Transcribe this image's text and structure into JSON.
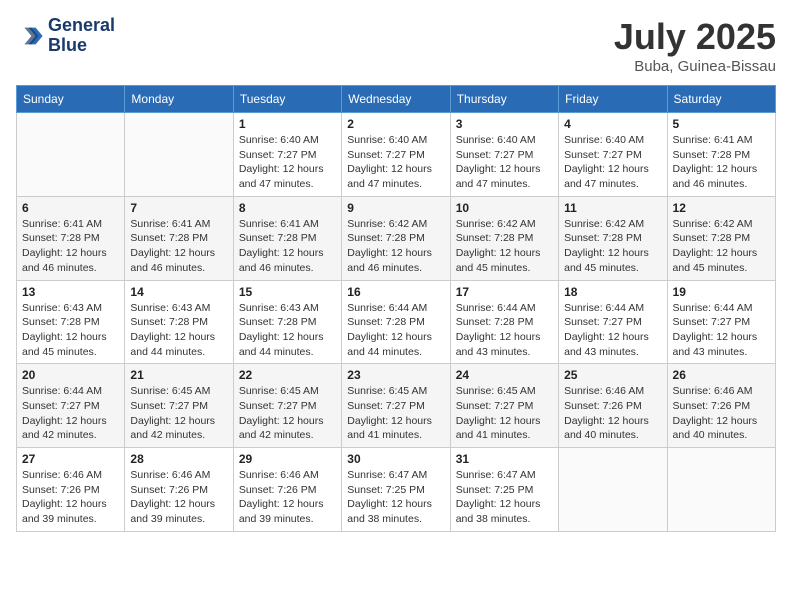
{
  "header": {
    "logo_line1": "General",
    "logo_line2": "Blue",
    "month_title": "July 2025",
    "location": "Buba, Guinea-Bissau"
  },
  "weekdays": [
    "Sunday",
    "Monday",
    "Tuesday",
    "Wednesday",
    "Thursday",
    "Friday",
    "Saturday"
  ],
  "weeks": [
    [
      null,
      null,
      {
        "day": 1,
        "sunrise": "6:40 AM",
        "sunset": "7:27 PM",
        "daylight": "12 hours and 47 minutes."
      },
      {
        "day": 2,
        "sunrise": "6:40 AM",
        "sunset": "7:27 PM",
        "daylight": "12 hours and 47 minutes."
      },
      {
        "day": 3,
        "sunrise": "6:40 AM",
        "sunset": "7:27 PM",
        "daylight": "12 hours and 47 minutes."
      },
      {
        "day": 4,
        "sunrise": "6:40 AM",
        "sunset": "7:27 PM",
        "daylight": "12 hours and 47 minutes."
      },
      {
        "day": 5,
        "sunrise": "6:41 AM",
        "sunset": "7:28 PM",
        "daylight": "12 hours and 46 minutes."
      }
    ],
    [
      {
        "day": 6,
        "sunrise": "6:41 AM",
        "sunset": "7:28 PM",
        "daylight": "12 hours and 46 minutes."
      },
      {
        "day": 7,
        "sunrise": "6:41 AM",
        "sunset": "7:28 PM",
        "daylight": "12 hours and 46 minutes."
      },
      {
        "day": 8,
        "sunrise": "6:41 AM",
        "sunset": "7:28 PM",
        "daylight": "12 hours and 46 minutes."
      },
      {
        "day": 9,
        "sunrise": "6:42 AM",
        "sunset": "7:28 PM",
        "daylight": "12 hours and 46 minutes."
      },
      {
        "day": 10,
        "sunrise": "6:42 AM",
        "sunset": "7:28 PM",
        "daylight": "12 hours and 45 minutes."
      },
      {
        "day": 11,
        "sunrise": "6:42 AM",
        "sunset": "7:28 PM",
        "daylight": "12 hours and 45 minutes."
      },
      {
        "day": 12,
        "sunrise": "6:42 AM",
        "sunset": "7:28 PM",
        "daylight": "12 hours and 45 minutes."
      }
    ],
    [
      {
        "day": 13,
        "sunrise": "6:43 AM",
        "sunset": "7:28 PM",
        "daylight": "12 hours and 45 minutes."
      },
      {
        "day": 14,
        "sunrise": "6:43 AM",
        "sunset": "7:28 PM",
        "daylight": "12 hours and 44 minutes."
      },
      {
        "day": 15,
        "sunrise": "6:43 AM",
        "sunset": "7:28 PM",
        "daylight": "12 hours and 44 minutes."
      },
      {
        "day": 16,
        "sunrise": "6:44 AM",
        "sunset": "7:28 PM",
        "daylight": "12 hours and 44 minutes."
      },
      {
        "day": 17,
        "sunrise": "6:44 AM",
        "sunset": "7:28 PM",
        "daylight": "12 hours and 43 minutes."
      },
      {
        "day": 18,
        "sunrise": "6:44 AM",
        "sunset": "7:27 PM",
        "daylight": "12 hours and 43 minutes."
      },
      {
        "day": 19,
        "sunrise": "6:44 AM",
        "sunset": "7:27 PM",
        "daylight": "12 hours and 43 minutes."
      }
    ],
    [
      {
        "day": 20,
        "sunrise": "6:44 AM",
        "sunset": "7:27 PM",
        "daylight": "12 hours and 42 minutes."
      },
      {
        "day": 21,
        "sunrise": "6:45 AM",
        "sunset": "7:27 PM",
        "daylight": "12 hours and 42 minutes."
      },
      {
        "day": 22,
        "sunrise": "6:45 AM",
        "sunset": "7:27 PM",
        "daylight": "12 hours and 42 minutes."
      },
      {
        "day": 23,
        "sunrise": "6:45 AM",
        "sunset": "7:27 PM",
        "daylight": "12 hours and 41 minutes."
      },
      {
        "day": 24,
        "sunrise": "6:45 AM",
        "sunset": "7:27 PM",
        "daylight": "12 hours and 41 minutes."
      },
      {
        "day": 25,
        "sunrise": "6:46 AM",
        "sunset": "7:26 PM",
        "daylight": "12 hours and 40 minutes."
      },
      {
        "day": 26,
        "sunrise": "6:46 AM",
        "sunset": "7:26 PM",
        "daylight": "12 hours and 40 minutes."
      }
    ],
    [
      {
        "day": 27,
        "sunrise": "6:46 AM",
        "sunset": "7:26 PM",
        "daylight": "12 hours and 39 minutes."
      },
      {
        "day": 28,
        "sunrise": "6:46 AM",
        "sunset": "7:26 PM",
        "daylight": "12 hours and 39 minutes."
      },
      {
        "day": 29,
        "sunrise": "6:46 AM",
        "sunset": "7:26 PM",
        "daylight": "12 hours and 39 minutes."
      },
      {
        "day": 30,
        "sunrise": "6:47 AM",
        "sunset": "7:25 PM",
        "daylight": "12 hours and 38 minutes."
      },
      {
        "day": 31,
        "sunrise": "6:47 AM",
        "sunset": "7:25 PM",
        "daylight": "12 hours and 38 minutes."
      },
      null,
      null
    ]
  ],
  "labels": {
    "sunrise_prefix": "Sunrise: ",
    "sunset_prefix": "Sunset: ",
    "daylight_prefix": "Daylight: "
  }
}
